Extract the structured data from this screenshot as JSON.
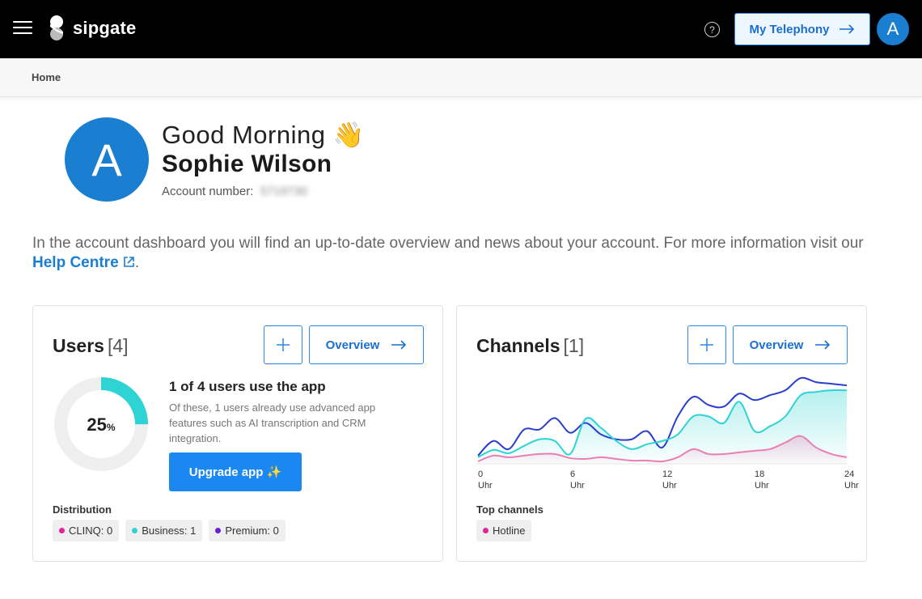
{
  "header": {
    "brand": "sipgate",
    "help_icon": "question-circle-icon",
    "help_glyph": "?",
    "my_telephony_label": "My Telephony",
    "arrow_glyph": "→",
    "avatar_letter": "A"
  },
  "breadcrumb": {
    "home": "Home"
  },
  "greeting": {
    "avatar_letter": "A",
    "text": "Good Morning",
    "emoji": "👋",
    "name": "Sophie Wilson",
    "account_label": "Account number:",
    "account_number": "5719730"
  },
  "intro": {
    "text_before": "In the account dashboard you will find an up-to-date overview and news about your account. For more information visit our ",
    "link_label": "Help Centre",
    "text_after": "."
  },
  "users_card": {
    "title": "Users",
    "count": "[4]",
    "plus_glyph": "+",
    "overview_label": "Overview",
    "donut_value": "25",
    "donut_unit": "%",
    "donut_fraction": 0.25,
    "app_title": "1 of 4 users use the app",
    "app_desc": "Of these, 1 users already use advanced app features such as AI transcription and CRM integration.",
    "upgrade_label": "Upgrade app ✨",
    "distribution_label": "Distribution",
    "chips": [
      {
        "label": "CLINQ: 0",
        "color": "#e0249a"
      },
      {
        "label": "Business: 1",
        "color": "#2ed3d3"
      },
      {
        "label": "Premium: 0",
        "color": "#6a1fd6"
      }
    ]
  },
  "channels_card": {
    "title": "Channels",
    "count": "[1]",
    "plus_glyph": "+",
    "overview_label": "Overview",
    "top_channels_label": "Top channels",
    "chips": [
      {
        "label": "Hotline",
        "color": "#e0249a"
      }
    ]
  },
  "colors": {
    "accent": "#1a7fd1",
    "cyan": "#2ed3d3",
    "blue_line": "#2a3fd0",
    "pink": "#e0249a"
  },
  "chart_data": {
    "type": "area",
    "x": [
      0,
      1,
      2,
      3,
      4,
      5,
      6,
      7,
      8,
      9,
      10,
      11,
      12,
      13,
      14,
      15,
      16,
      17,
      18,
      19,
      20,
      21,
      22,
      23,
      24
    ],
    "xlim": [
      0,
      24
    ],
    "tick_labels": [
      {
        "value": "0",
        "unit": "Uhr",
        "x": 0
      },
      {
        "value": "6",
        "unit": "Uhr",
        "x": 6
      },
      {
        "value": "12",
        "unit": "Uhr",
        "x": 12
      },
      {
        "value": "18",
        "unit": "Uhr",
        "x": 18
      },
      {
        "value": "24",
        "unit": "Uhr",
        "x": 24
      }
    ],
    "ylim": [
      0,
      110
    ],
    "grid": false,
    "series": [
      {
        "color": "#2a3fd0",
        "fill": false,
        "values": [
          10,
          28,
          18,
          42,
          42,
          56,
          38,
          50,
          36,
          30,
          30,
          40,
          20,
          58,
          82,
          72,
          70,
          86,
          78,
          84,
          90,
          105,
          100,
          98,
          96
        ]
      },
      {
        "color": "#2ed3d3",
        "fill": true,
        "values": [
          8,
          17,
          13,
          22,
          30,
          28,
          12,
          55,
          44,
          28,
          18,
          24,
          28,
          36,
          58,
          58,
          50,
          76,
          40,
          46,
          58,
          84,
          88,
          90,
          90
        ]
      },
      {
        "color": "#e97fb3",
        "fill": true,
        "values": [
          3,
          10,
          8,
          10,
          12,
          12,
          7,
          6,
          8,
          6,
          4,
          4,
          3,
          8,
          18,
          12,
          12,
          14,
          16,
          18,
          26,
          34,
          20,
          12,
          8
        ]
      }
    ]
  }
}
